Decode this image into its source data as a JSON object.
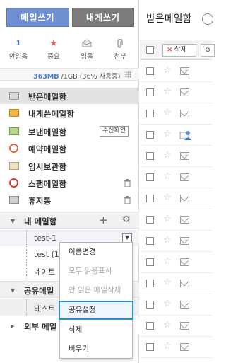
{
  "sidebar": {
    "write_mail": "메일쓰기",
    "write_to_me": "내게쓰기",
    "filters": [
      {
        "count": "1",
        "label": "안읽음",
        "icon": "unread-count"
      },
      {
        "label": "중요",
        "icon": "star-icon"
      },
      {
        "label": "읽음",
        "icon": "open-envelope-icon"
      },
      {
        "label": "첨부",
        "icon": "paperclip-icon"
      }
    ],
    "storage": {
      "used": "363MB",
      "rest": " /1GB (36% 사용중)"
    },
    "mailboxes": [
      {
        "label": "받은메일함",
        "icon": "inbox-icon"
      },
      {
        "label": "내게쓴메일함",
        "icon": "self-mail-icon"
      },
      {
        "label": "보낸메일함",
        "icon": "sent-icon",
        "badge": "수신확인"
      },
      {
        "label": "예약메일함",
        "icon": "reserved-clock-icon"
      },
      {
        "label": "임시보관함",
        "icon": "draft-icon"
      },
      {
        "label": "스팸메일함",
        "icon": "spam-icon"
      },
      {
        "label": "휴지통",
        "icon": "trash-bin-icon"
      }
    ],
    "my_mailbox": {
      "label": "내 메일함",
      "plus": "+",
      "gear": "⚙"
    },
    "my_items": [
      "test-1",
      "test (1",
      "네이트"
    ],
    "shared": {
      "label": "공유메일"
    },
    "shared_items": [
      "테스트"
    ],
    "external": {
      "label": "외부 메일"
    }
  },
  "context_menu": {
    "items": [
      {
        "label": "이름변경",
        "state": "normal"
      },
      {
        "label": "모두 읽음표시",
        "state": "disabled"
      },
      {
        "label": "안 읽은 메일삭제",
        "state": "disabled"
      },
      {
        "label": "공유설정",
        "state": "active"
      },
      {
        "label": "삭제",
        "state": "normal"
      },
      {
        "label": "비우기",
        "state": "normal"
      }
    ]
  },
  "main": {
    "title": "받은메일함",
    "delete_label": "삭제",
    "next_label": "⊘",
    "row_count": 14,
    "shared_row_index": 3,
    "star_glyph": "☆"
  },
  "colors": {
    "primary_button": "#6e8fd2",
    "dark_button": "#7b7b7b",
    "highlight_border": "#2a90d0",
    "unread_count": "#4b7bd8",
    "star_red": "#e0646c"
  }
}
